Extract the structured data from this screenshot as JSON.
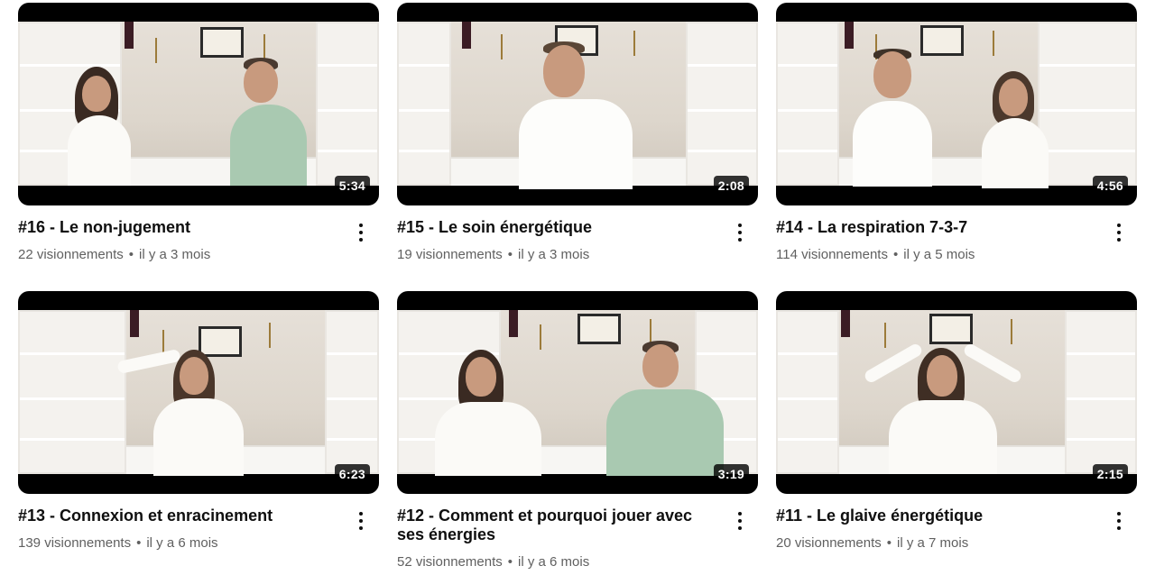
{
  "videos": [
    {
      "title": "#16 - Le non-jugement",
      "views": "22 visionnements",
      "age": "il y a 3 mois",
      "duration": "5:34",
      "dot": "•"
    },
    {
      "title": "#15 - Le soin énergétique",
      "views": "19 visionnements",
      "age": "il y a 3 mois",
      "duration": "2:08",
      "dot": "•"
    },
    {
      "title": "#14 - La respiration 7-3-7",
      "views": "114 visionnements",
      "age": "il y a 5 mois",
      "duration": "4:56",
      "dot": "•"
    },
    {
      "title": "#13 - Connexion et enracinement",
      "views": "139 visionnements",
      "age": "il y a 6 mois",
      "duration": "6:23",
      "dot": "•"
    },
    {
      "title": "#12 - Comment et pourquoi jouer avec ses énergies",
      "views": "52 visionnements",
      "age": "il y a 6 mois",
      "duration": "3:19",
      "dot": "•"
    },
    {
      "title": "#11 - Le glaive énergétique",
      "views": "20 visionnements",
      "age": "il y a 7 mois",
      "duration": "2:15",
      "dot": "•"
    }
  ],
  "icons": {
    "more": "more-vert-icon"
  },
  "colors": {
    "title": "#0f0f0f",
    "meta": "#606060",
    "duration_bg": "#000000cc"
  }
}
